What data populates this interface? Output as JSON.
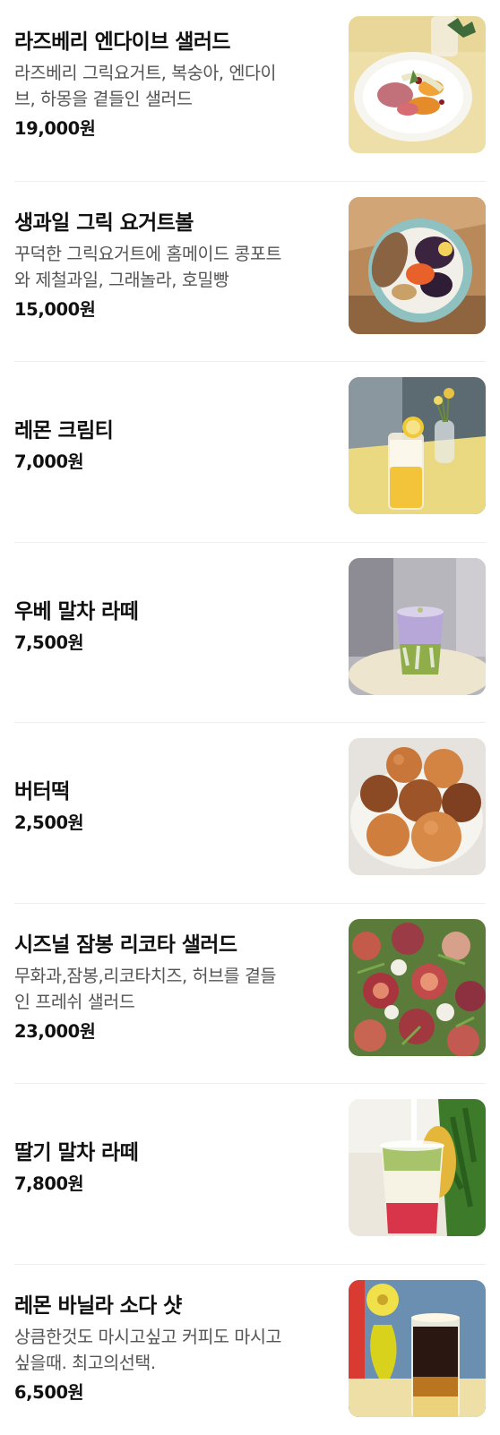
{
  "menu": {
    "items": [
      {
        "name": "라즈베리 엔다이브 샐러드",
        "description_lines": [
          "라즈베리 그릭요거트, 복숭아, 엔다이",
          "브, 하몽을 곁들인 샐러드"
        ],
        "price": "19,000원",
        "image": "raspberry-endive-salad-photo"
      },
      {
        "name": "생과일 그릭 요거트볼",
        "description_lines": [
          "꾸덕한 그릭요거트에 홈메이드 콩포트",
          "와 제철과일, 그래놀라, 호밀빵"
        ],
        "price": "15,000원",
        "image": "greek-yogurt-bowl-photo"
      },
      {
        "name": "레몬 크림티",
        "description_lines": [],
        "price": "7,000원",
        "image": "lemon-cream-tea-photo"
      },
      {
        "name": "우베 말차 라떼",
        "description_lines": [],
        "price": "7,500원",
        "image": "ube-matcha-latte-photo"
      },
      {
        "name": "버터떡",
        "description_lines": [],
        "price": "2,500원",
        "image": "butter-rice-cake-photo"
      },
      {
        "name": "시즈널 잠봉 리코타 샐러드",
        "description_lines": [
          "무화과,잠봉,리코타치즈, 허브를 곁들",
          "인 프레쉬 샐러드"
        ],
        "price": "23,000원",
        "image": "seasonal-jambon-ricotta-salad-photo"
      },
      {
        "name": "딸기 말차 라떼",
        "description_lines": [],
        "price": "7,800원",
        "image": "strawberry-matcha-latte-photo"
      },
      {
        "name": "레몬 바닐라 소다 샷",
        "description_lines": [
          "상큼한것도 마시고싶고 커피도 마시고",
          "싶을때. 최고의선택."
        ],
        "price": "6,500원",
        "image": "lemon-vanilla-soda-shot-photo"
      }
    ]
  }
}
